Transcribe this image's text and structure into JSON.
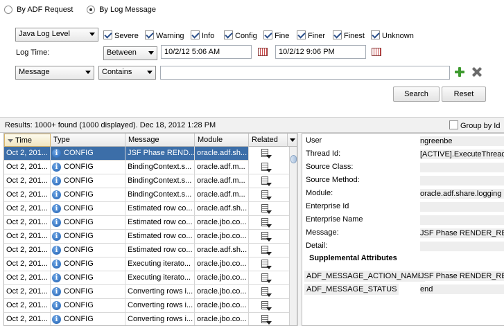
{
  "search_mode": {
    "options": [
      {
        "label": "By ADF Request",
        "selected": false
      },
      {
        "label": "By Log Message",
        "selected": true
      }
    ]
  },
  "filters": {
    "log_level_type": "Java Log Level",
    "levels": [
      {
        "label": "Severe",
        "checked": true
      },
      {
        "label": "Warning",
        "checked": true
      },
      {
        "label": "Info",
        "checked": true
      },
      {
        "label": "Config",
        "checked": true
      },
      {
        "label": "Fine",
        "checked": true
      },
      {
        "label": "Finer",
        "checked": true
      },
      {
        "label": "Finest",
        "checked": true
      },
      {
        "label": "Unknown",
        "checked": true
      }
    ],
    "log_time_label": "Log Time:",
    "time_operator": "Between",
    "time_from": "10/2/12 5:06 AM",
    "time_to": "10/2/12 9:06 PM",
    "field": "Message",
    "operator": "Contains",
    "search_value": "",
    "search_label": "Search",
    "reset_label": "Reset"
  },
  "results": {
    "summary": "Results:  1000+ found (1000 displayed). Dec 18, 2012 1:28 PM",
    "group_by_label": "Group by Id",
    "group_by_checked": false
  },
  "table": {
    "columns": [
      "Time",
      "Type",
      "Message",
      "Module",
      "Related"
    ],
    "rows": [
      {
        "time": "Oct 2, 201...",
        "type": "CONFIG",
        "message": "JSF Phase REND...",
        "module": "oracle.adf.sh...",
        "selected": true
      },
      {
        "time": "Oct 2, 201...",
        "type": "CONFIG",
        "message": "BindingContext.s...",
        "module": "oracle.adf.m...",
        "selected": false
      },
      {
        "time": "Oct 2, 201...",
        "type": "CONFIG",
        "message": "BindingContext.s...",
        "module": "oracle.adf.m...",
        "selected": false
      },
      {
        "time": "Oct 2, 201...",
        "type": "CONFIG",
        "message": "BindingContext.s...",
        "module": "oracle.adf.m...",
        "selected": false
      },
      {
        "time": "Oct 2, 201...",
        "type": "CONFIG",
        "message": "Estimated row co...",
        "module": "oracle.adf.sh...",
        "selected": false
      },
      {
        "time": "Oct 2, 201...",
        "type": "CONFIG",
        "message": "Estimated row co...",
        "module": "oracle.jbo.co...",
        "selected": false
      },
      {
        "time": "Oct 2, 201...",
        "type": "CONFIG",
        "message": "Estimated row co...",
        "module": "oracle.jbo.co...",
        "selected": false
      },
      {
        "time": "Oct 2, 201...",
        "type": "CONFIG",
        "message": "Estimated row co...",
        "module": "oracle.adf.sh...",
        "selected": false
      },
      {
        "time": "Oct 2, 201...",
        "type": "CONFIG",
        "message": "Executing iterato...",
        "module": "oracle.jbo.co...",
        "selected": false
      },
      {
        "time": "Oct 2, 201...",
        "type": "CONFIG",
        "message": "Executing iterato...",
        "module": "oracle.jbo.co...",
        "selected": false
      },
      {
        "time": "Oct 2, 201...",
        "type": "CONFIG",
        "message": "Converting rows i...",
        "module": "oracle.jbo.co...",
        "selected": false
      },
      {
        "time": "Oct 2, 201...",
        "type": "CONFIG",
        "message": "Converting rows i...",
        "module": "oracle.jbo.co...",
        "selected": false
      },
      {
        "time": "Oct 2, 201...",
        "type": "CONFIG",
        "message": "Converting rows i...",
        "module": "oracle.jbo.co...",
        "selected": false
      }
    ]
  },
  "detail": {
    "fields": [
      {
        "label": "User",
        "value": "ngreenbe"
      },
      {
        "label": "Thread Id:",
        "value": "[ACTIVE].ExecuteThread"
      },
      {
        "label": "Source Class:",
        "value": ""
      },
      {
        "label": "Source Method:",
        "value": ""
      },
      {
        "label": "Module:",
        "value": "oracle.adf.share.logging"
      },
      {
        "label": "Enterprise Id",
        "value": ""
      },
      {
        "label": "Enterprise Name",
        "value": ""
      },
      {
        "label": "Message:",
        "value": "JSF Phase RENDER_RES"
      },
      {
        "label": "Detail:",
        "value": ""
      }
    ],
    "supplemental_title": "Supplemental Attributes",
    "supplemental": [
      {
        "label": "ADF_MESSAGE_ACTION_NAME",
        "value": "JSF Phase RENDER_RES"
      },
      {
        "label": "ADF_MESSAGE_STATUS",
        "value": "end"
      }
    ]
  }
}
